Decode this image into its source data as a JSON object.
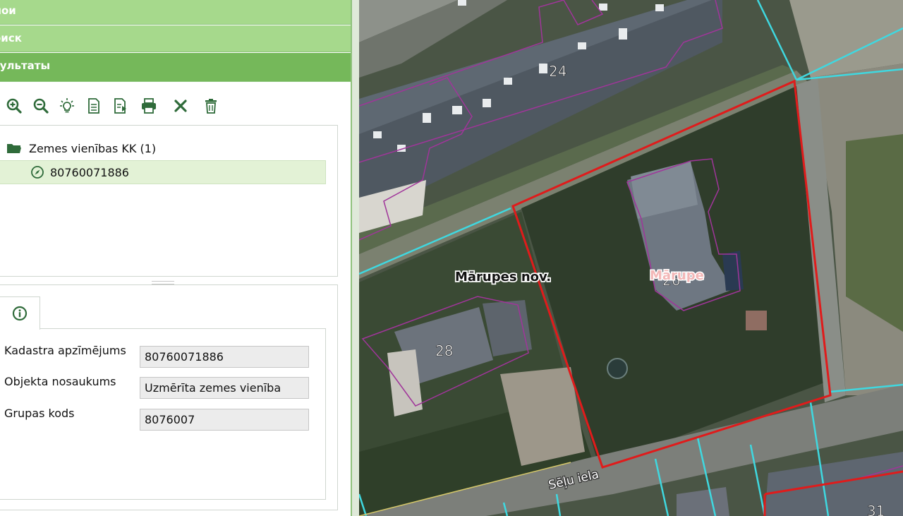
{
  "accordion": {
    "layers_label": "лои",
    "search_label": "оиск",
    "results_label": "зультаты"
  },
  "toolbar": {
    "icons": [
      "zoom-in-icon",
      "zoom-out-icon",
      "highlight-icon",
      "document-icon",
      "export-icon",
      "print-icon",
      "close-icon",
      "trash-icon"
    ]
  },
  "tree": {
    "group_label": "Zemes vienības KK (1)",
    "item_label": "80760071886"
  },
  "details": {
    "tab_icon": "info-icon",
    "fields": [
      {
        "label": "Kadastra apzīmējums",
        "value": "80760071886"
      },
      {
        "label": "Objekta nosaukums",
        "value": "Uzmērīta zemes vienība"
      },
      {
        "label": "Grupas kods",
        "value": "8076007"
      }
    ]
  },
  "map": {
    "labels": {
      "municipality": "Mārupes nov.",
      "town": "Mārupe",
      "street": "Sēļu iela",
      "building_24": "24",
      "building_28": "28",
      "building_31": "31",
      "building_26": "26"
    },
    "colors": {
      "parcel_selected": "#e01b1b",
      "parcel_boundary": "#3fd8e0",
      "building_outline": "#a0359a"
    }
  }
}
